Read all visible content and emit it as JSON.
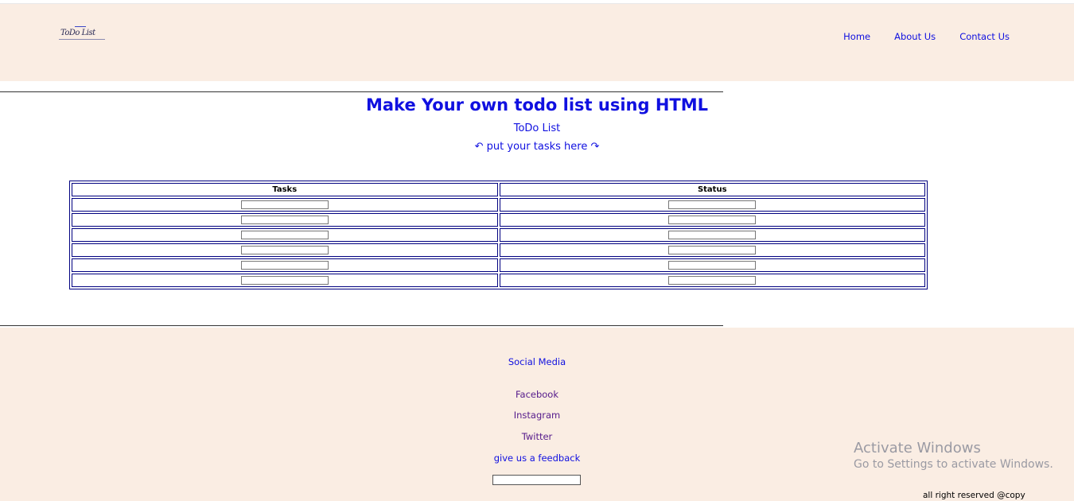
{
  "header": {
    "logo_text": "ToDo List",
    "nav": [
      "Home",
      "About Us",
      "Contact Us"
    ]
  },
  "main": {
    "title": "Make Your own todo list using HTML",
    "subtitle": "ToDo List",
    "tagline": "↶ put your tasks here ↷",
    "table": {
      "headers": [
        "Tasks",
        "Status"
      ],
      "row_count": 6
    }
  },
  "footer": {
    "social_title": "Social Media",
    "links": [
      "Facebook",
      "Instagram",
      "Twitter"
    ],
    "feedback_label": "give us a feedback",
    "copyright": "all right reserved @copy"
  },
  "watermark": {
    "line1": "Activate Windows",
    "line2": "Go to Settings to activate Windows."
  },
  "colors": {
    "band_bg": "#faede3",
    "link": "#1010e0",
    "visited": "#551a8b",
    "table_border": "#000080"
  }
}
